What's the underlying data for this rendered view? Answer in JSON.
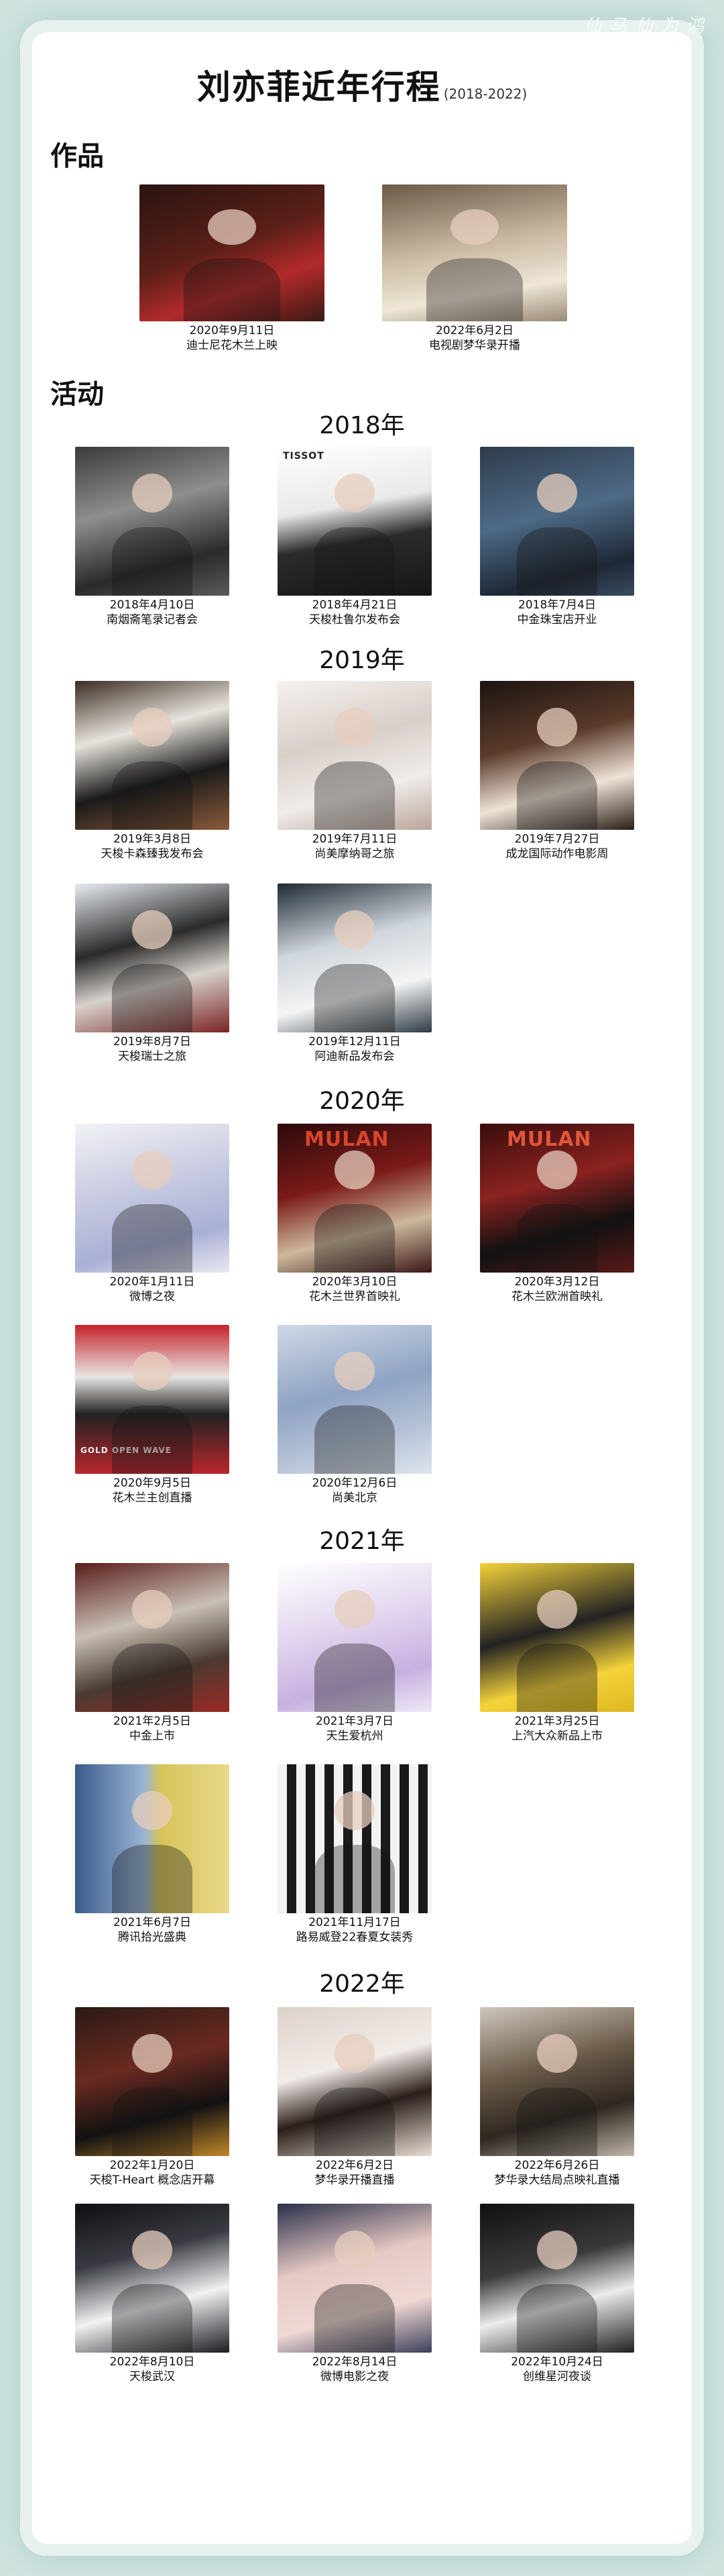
{
  "corner_text": "仙 马 仙 为 鸿",
  "title": "刘亦菲近年行程",
  "title_sub": "(2018-2022)",
  "section_works": "作品",
  "section_events": "活动",
  "works": [
    {
      "date": "2020年9月11日",
      "label": "迪士尼花木兰上映"
    },
    {
      "date": "2022年6月2日",
      "label": "电视剧梦华录开播"
    }
  ],
  "years": {
    "y2018": "2018年",
    "y2019": "2019年",
    "y2020": "2020年",
    "y2021": "2021年",
    "y2022": "2022年"
  },
  "events2018": [
    {
      "date": "2018年4月10日",
      "label": "南烟斋笔录记者会"
    },
    {
      "date": "2018年4月21日",
      "label": "天梭杜鲁尔发布会",
      "brand": "TISSOT"
    },
    {
      "date": "2018年7月4日",
      "label": "中金珠宝店开业"
    }
  ],
  "events2019": [
    {
      "date": "2019年3月8日",
      "label": "天梭卡森臻我发布会"
    },
    {
      "date": "2019年7月11日",
      "label": "尚美摩纳哥之旅"
    },
    {
      "date": "2019年7月27日",
      "label": "成龙国际动作电影周"
    },
    {
      "date": "2019年8月7日",
      "label": "天梭瑞士之旅"
    },
    {
      "date": "2019年12月11日",
      "label": "阿迪新品发布会"
    }
  ],
  "events2020": [
    {
      "date": "2020年1月11日",
      "label": "微博之夜"
    },
    {
      "date": "2020年3月10日",
      "label": "花木兰世界首映礼",
      "brand": "MULAN"
    },
    {
      "date": "2020年3月12日",
      "label": "花木兰欧洲首映礼",
      "brand": "MULAN"
    },
    {
      "date": "2020年9月5日",
      "label": "花木兰主创直播",
      "brand": "GOLD OPEN WAVE"
    },
    {
      "date": "2020年12月6日",
      "label": "尚美北京"
    }
  ],
  "events2021": [
    {
      "date": "2021年2月5日",
      "label": "中金上市"
    },
    {
      "date": "2021年3月7日",
      "label": "天生爱杭州"
    },
    {
      "date": "2021年3月25日",
      "label": "上汽大众新品上市"
    },
    {
      "date": "2021年6月7日",
      "label": "腾讯拾光盛典"
    },
    {
      "date": "2021年11月17日",
      "label": "路易威登22春夏女装秀"
    }
  ],
  "events2022": [
    {
      "date": "2022年1月20日",
      "label": "天梭T-Heart 概念店开幕"
    },
    {
      "date": "2022年6月2日",
      "label": "梦华录开播直播"
    },
    {
      "date": "2022年6月26日",
      "label": "梦华录大结局点映礼直播"
    },
    {
      "date": "2022年8月10日",
      "label": "天梭武汉"
    },
    {
      "date": "2022年8月14日",
      "label": "微博电影之夜"
    },
    {
      "date": "2022年10月24日",
      "label": "创维星河夜谈"
    }
  ]
}
